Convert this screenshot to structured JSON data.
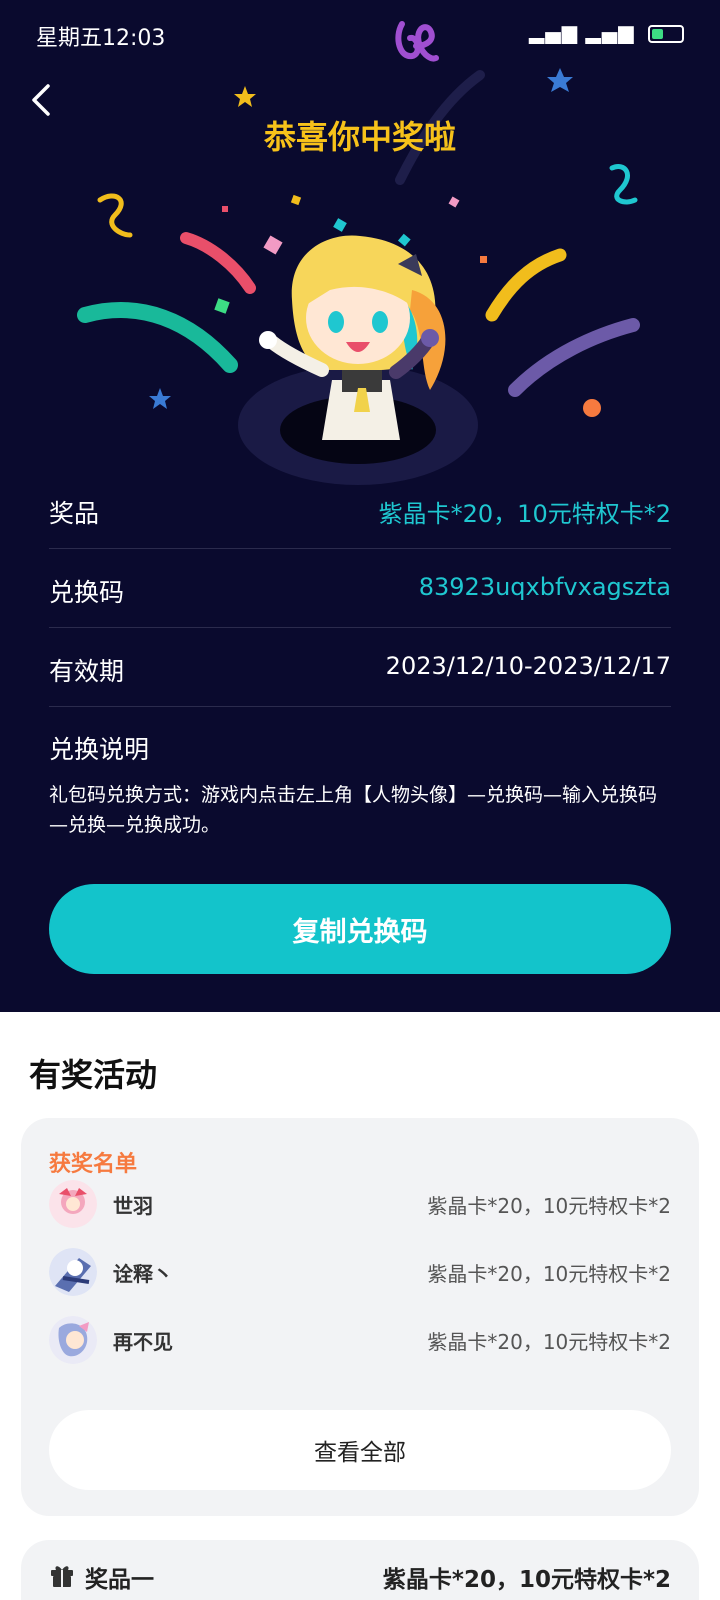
{
  "status_bar": {
    "time": "星期五12:03",
    "network": "4G",
    "battery_level": 0.4
  },
  "header": {
    "title": "恭喜你中奖啦"
  },
  "prize_info": {
    "prize_label": "奖品",
    "prize_value": "紫晶卡*20，10元特权卡*2",
    "code_label": "兑换码",
    "code_value": "83923uqxbfvxagszta",
    "validity_label": "有效期",
    "validity_value": "2023/12/10-2023/12/17",
    "instructions_title": "兑换说明",
    "instructions_text": "礼包码兑换方式：游戏内点击左上角【人物头像】—兑换码—输入兑换码—兑换—兑换成功。"
  },
  "copy_button": {
    "label": "复制兑换码"
  },
  "activity": {
    "title": "有奖活动",
    "winners_heading": "获奖名单",
    "winners": [
      {
        "name": "世羽",
        "prize": "紫晶卡*20，10元特权卡*2"
      },
      {
        "name": "诠释丶",
        "prize": "紫晶卡*20，10元特权卡*2"
      },
      {
        "name": "再不见",
        "prize": "紫晶卡*20，10元特权卡*2"
      }
    ],
    "view_all_label": "查看全部"
  },
  "prize_list": [
    {
      "label": "奖品一",
      "value": "紫晶卡*20，10元特权卡*2"
    }
  ],
  "colors": {
    "background_dark": "#0a0a2e",
    "accent_cyan": "#13c4cb",
    "title_gold": "#f7c21a",
    "heading_orange": "#f67a3f"
  },
  "icons": [
    "back-arrow-icon",
    "app-logo-icon",
    "gift-icon"
  ]
}
